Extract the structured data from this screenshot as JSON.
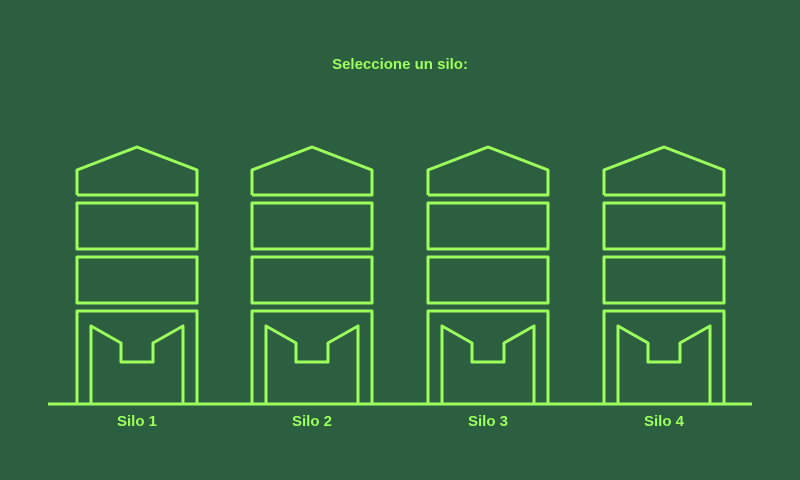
{
  "prompt": "Seleccione un silo:",
  "silos": [
    {
      "label": "Silo 1"
    },
    {
      "label": "Silo 2"
    },
    {
      "label": "Silo 3"
    },
    {
      "label": "Silo 4"
    }
  ],
  "colors": {
    "background": "#2c5e40",
    "accent": "#9dff5c"
  }
}
